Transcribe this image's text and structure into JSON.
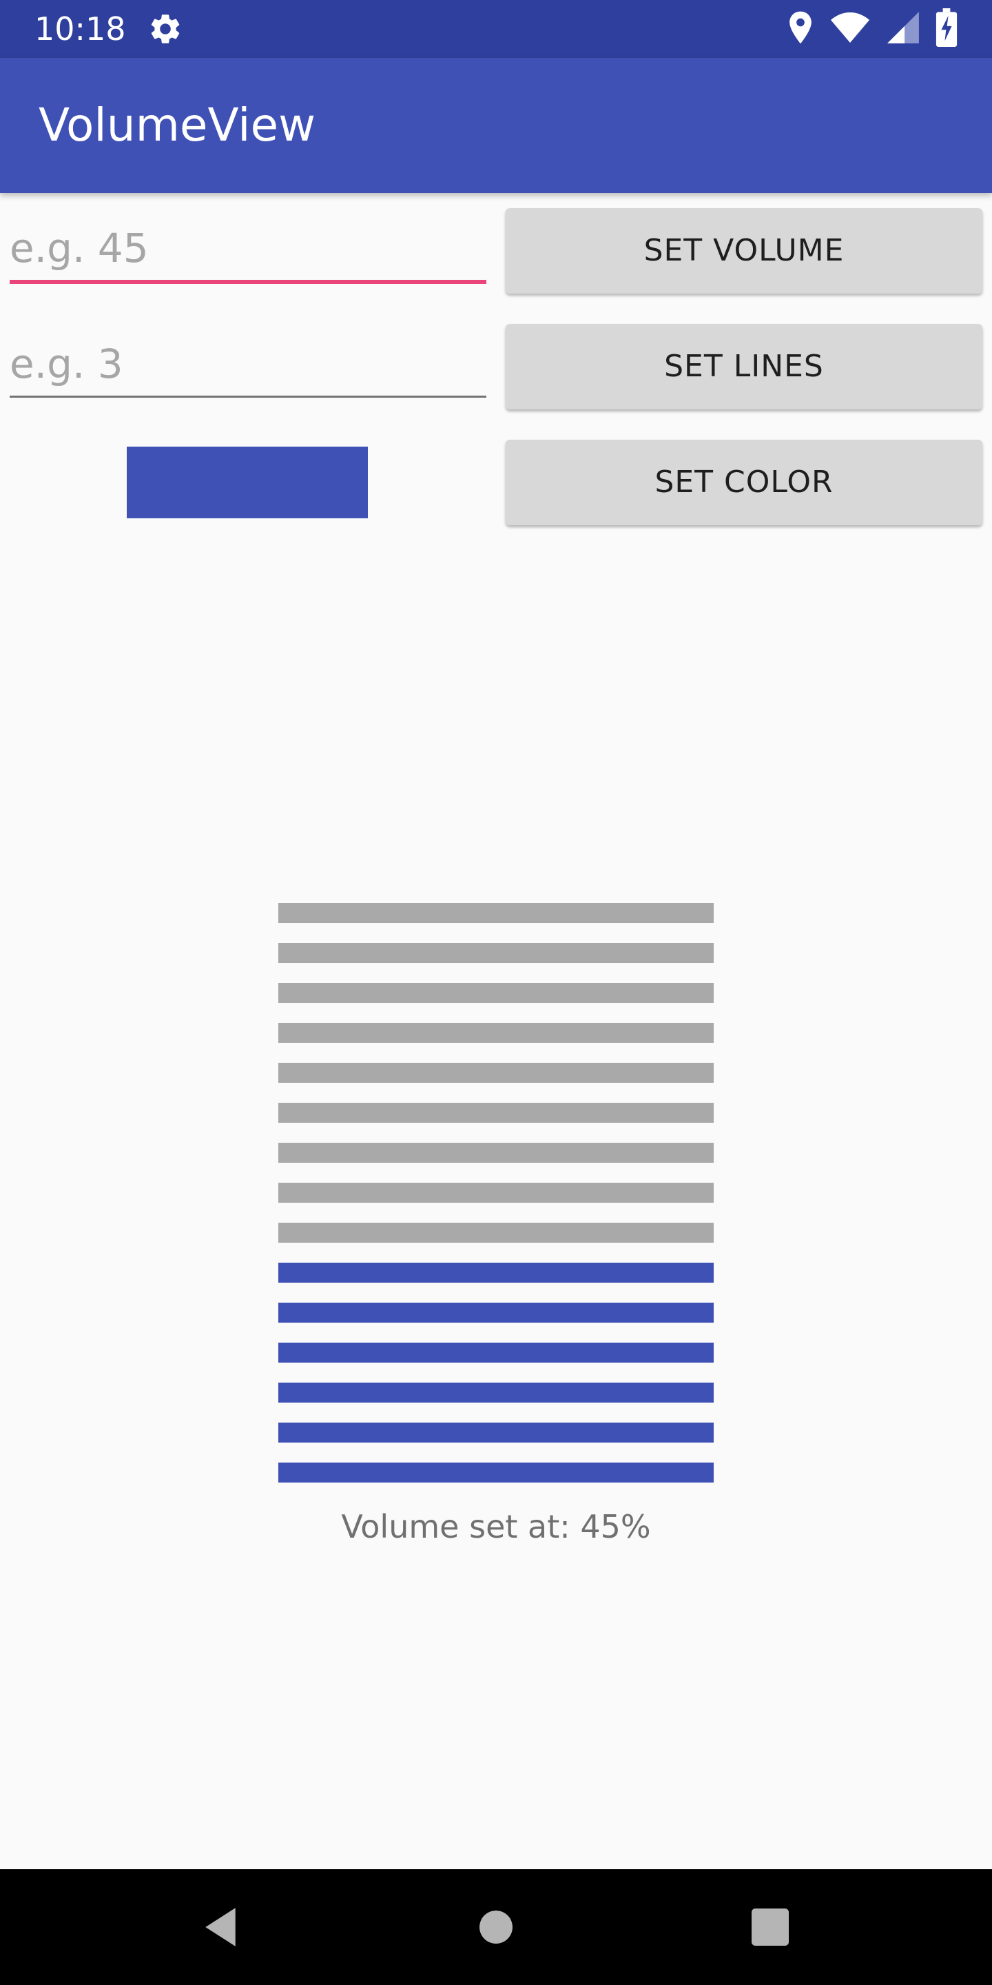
{
  "status_bar": {
    "time": "10:18",
    "icons": [
      "gear-icon",
      "location-icon",
      "wifi-icon",
      "signal-icon",
      "battery-icon"
    ],
    "color": "#2f3f9e"
  },
  "app_bar": {
    "title": "VolumeView",
    "color": "#3f51b5"
  },
  "inputs": {
    "volume": {
      "placeholder": "e.g. 45",
      "value": "",
      "focused": true,
      "underline_color": "#e9457a"
    },
    "lines": {
      "placeholder": "e.g. 3",
      "value": "",
      "focused": false,
      "underline_color": "#737373"
    }
  },
  "buttons": {
    "set_volume": "SET VOLUME",
    "set_lines": "SET LINES",
    "set_color": "SET COLOR"
  },
  "color_swatch": {
    "color": "#3f51b5"
  },
  "volume_view": {
    "total_lines": 15,
    "active_lines": 6,
    "active_color": "#3f51b5",
    "inactive_color": "#a9a9a9",
    "label": "Volume set at: 45%"
  },
  "nav_bar": {
    "icons": [
      "back-icon",
      "home-icon",
      "recents-icon"
    ]
  }
}
